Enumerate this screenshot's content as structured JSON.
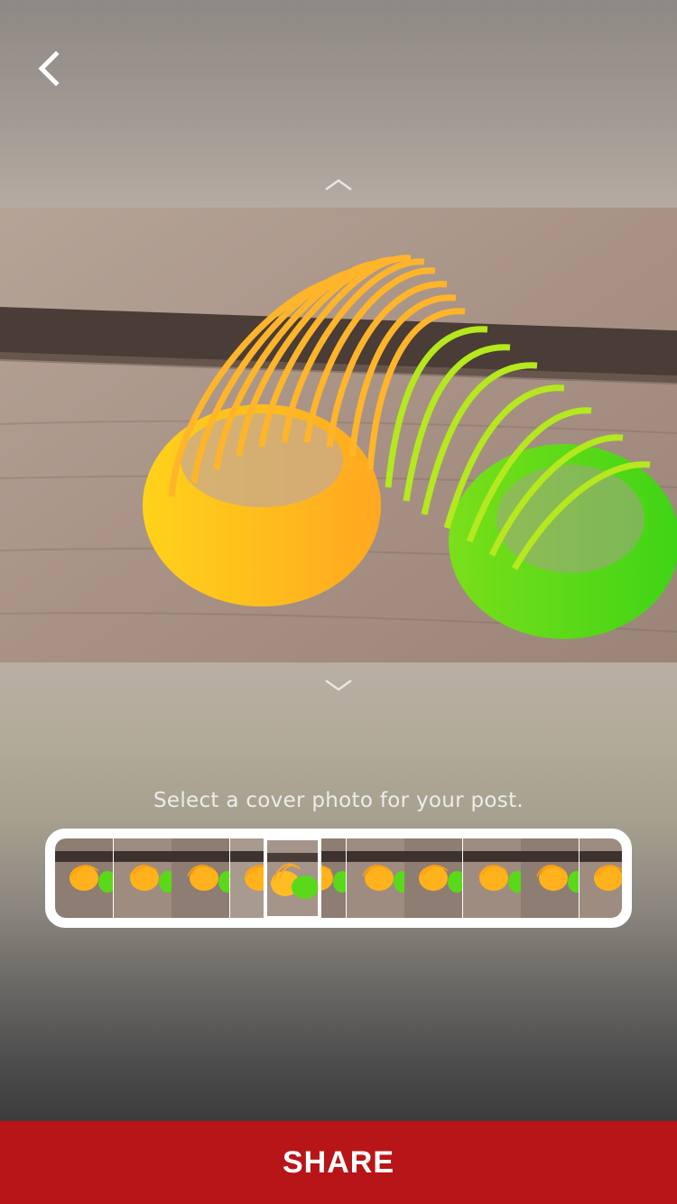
{
  "header": {
    "back_icon": "chevron-left-icon"
  },
  "preview": {
    "expand_up_icon": "chevron-up-icon",
    "collapse_down_icon": "chevron-down-icon",
    "image_description": "slinky-photo"
  },
  "cover": {
    "prompt": "Select a cover photo for your post.",
    "thumbnail_count": 10,
    "selected_index": 4
  },
  "footer": {
    "share_label": "SHARE"
  },
  "colors": {
    "share_red": "#b81518",
    "white": "#ffffff"
  }
}
